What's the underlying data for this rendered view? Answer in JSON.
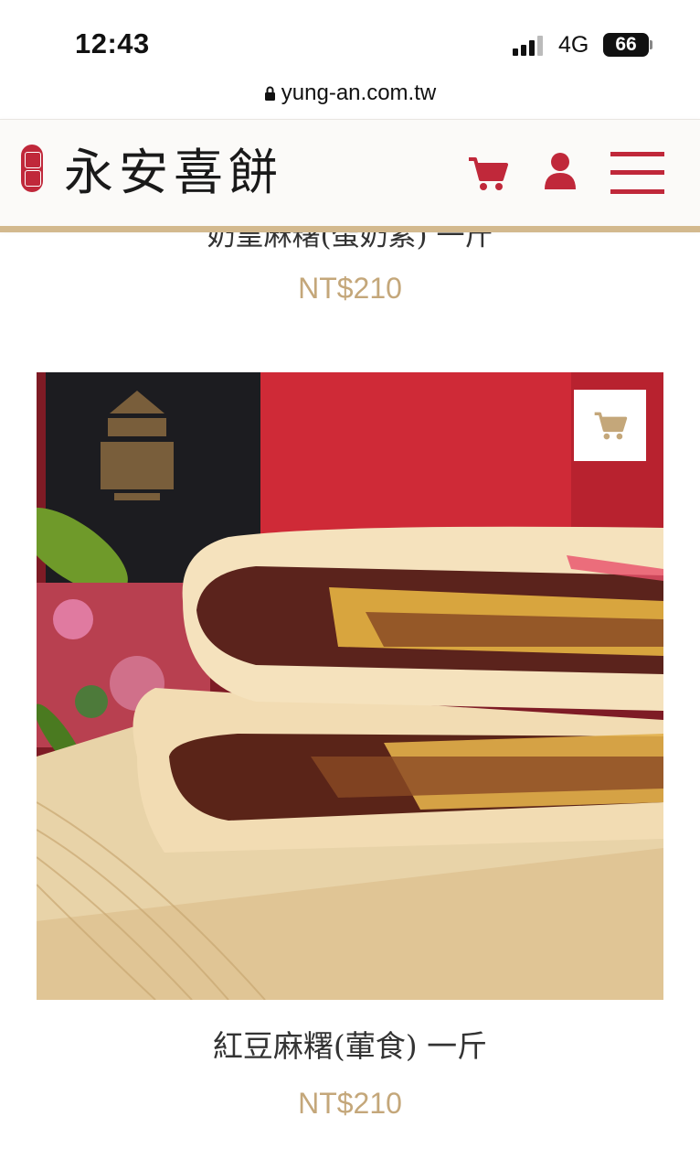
{
  "status_bar": {
    "time": "12:43",
    "network": "4G",
    "battery": "66"
  },
  "browser": {
    "url": "yung-an.com.tw"
  },
  "site": {
    "logo_text": "永安喜餅"
  },
  "products": [
    {
      "title": "奶皇麻糬(蛋奶素) 一斤",
      "price": "NT$210"
    },
    {
      "title": "紅豆麻糬(葷食) 一斤",
      "price": "NT$210"
    }
  ],
  "colors": {
    "brand_red": "#c0283a",
    "price_gold": "#c4a77a",
    "header_gold_line": "#d3b98e"
  },
  "icons": [
    "lock-icon",
    "cart-icon",
    "user-icon",
    "menu-icon",
    "add-to-cart-icon"
  ]
}
